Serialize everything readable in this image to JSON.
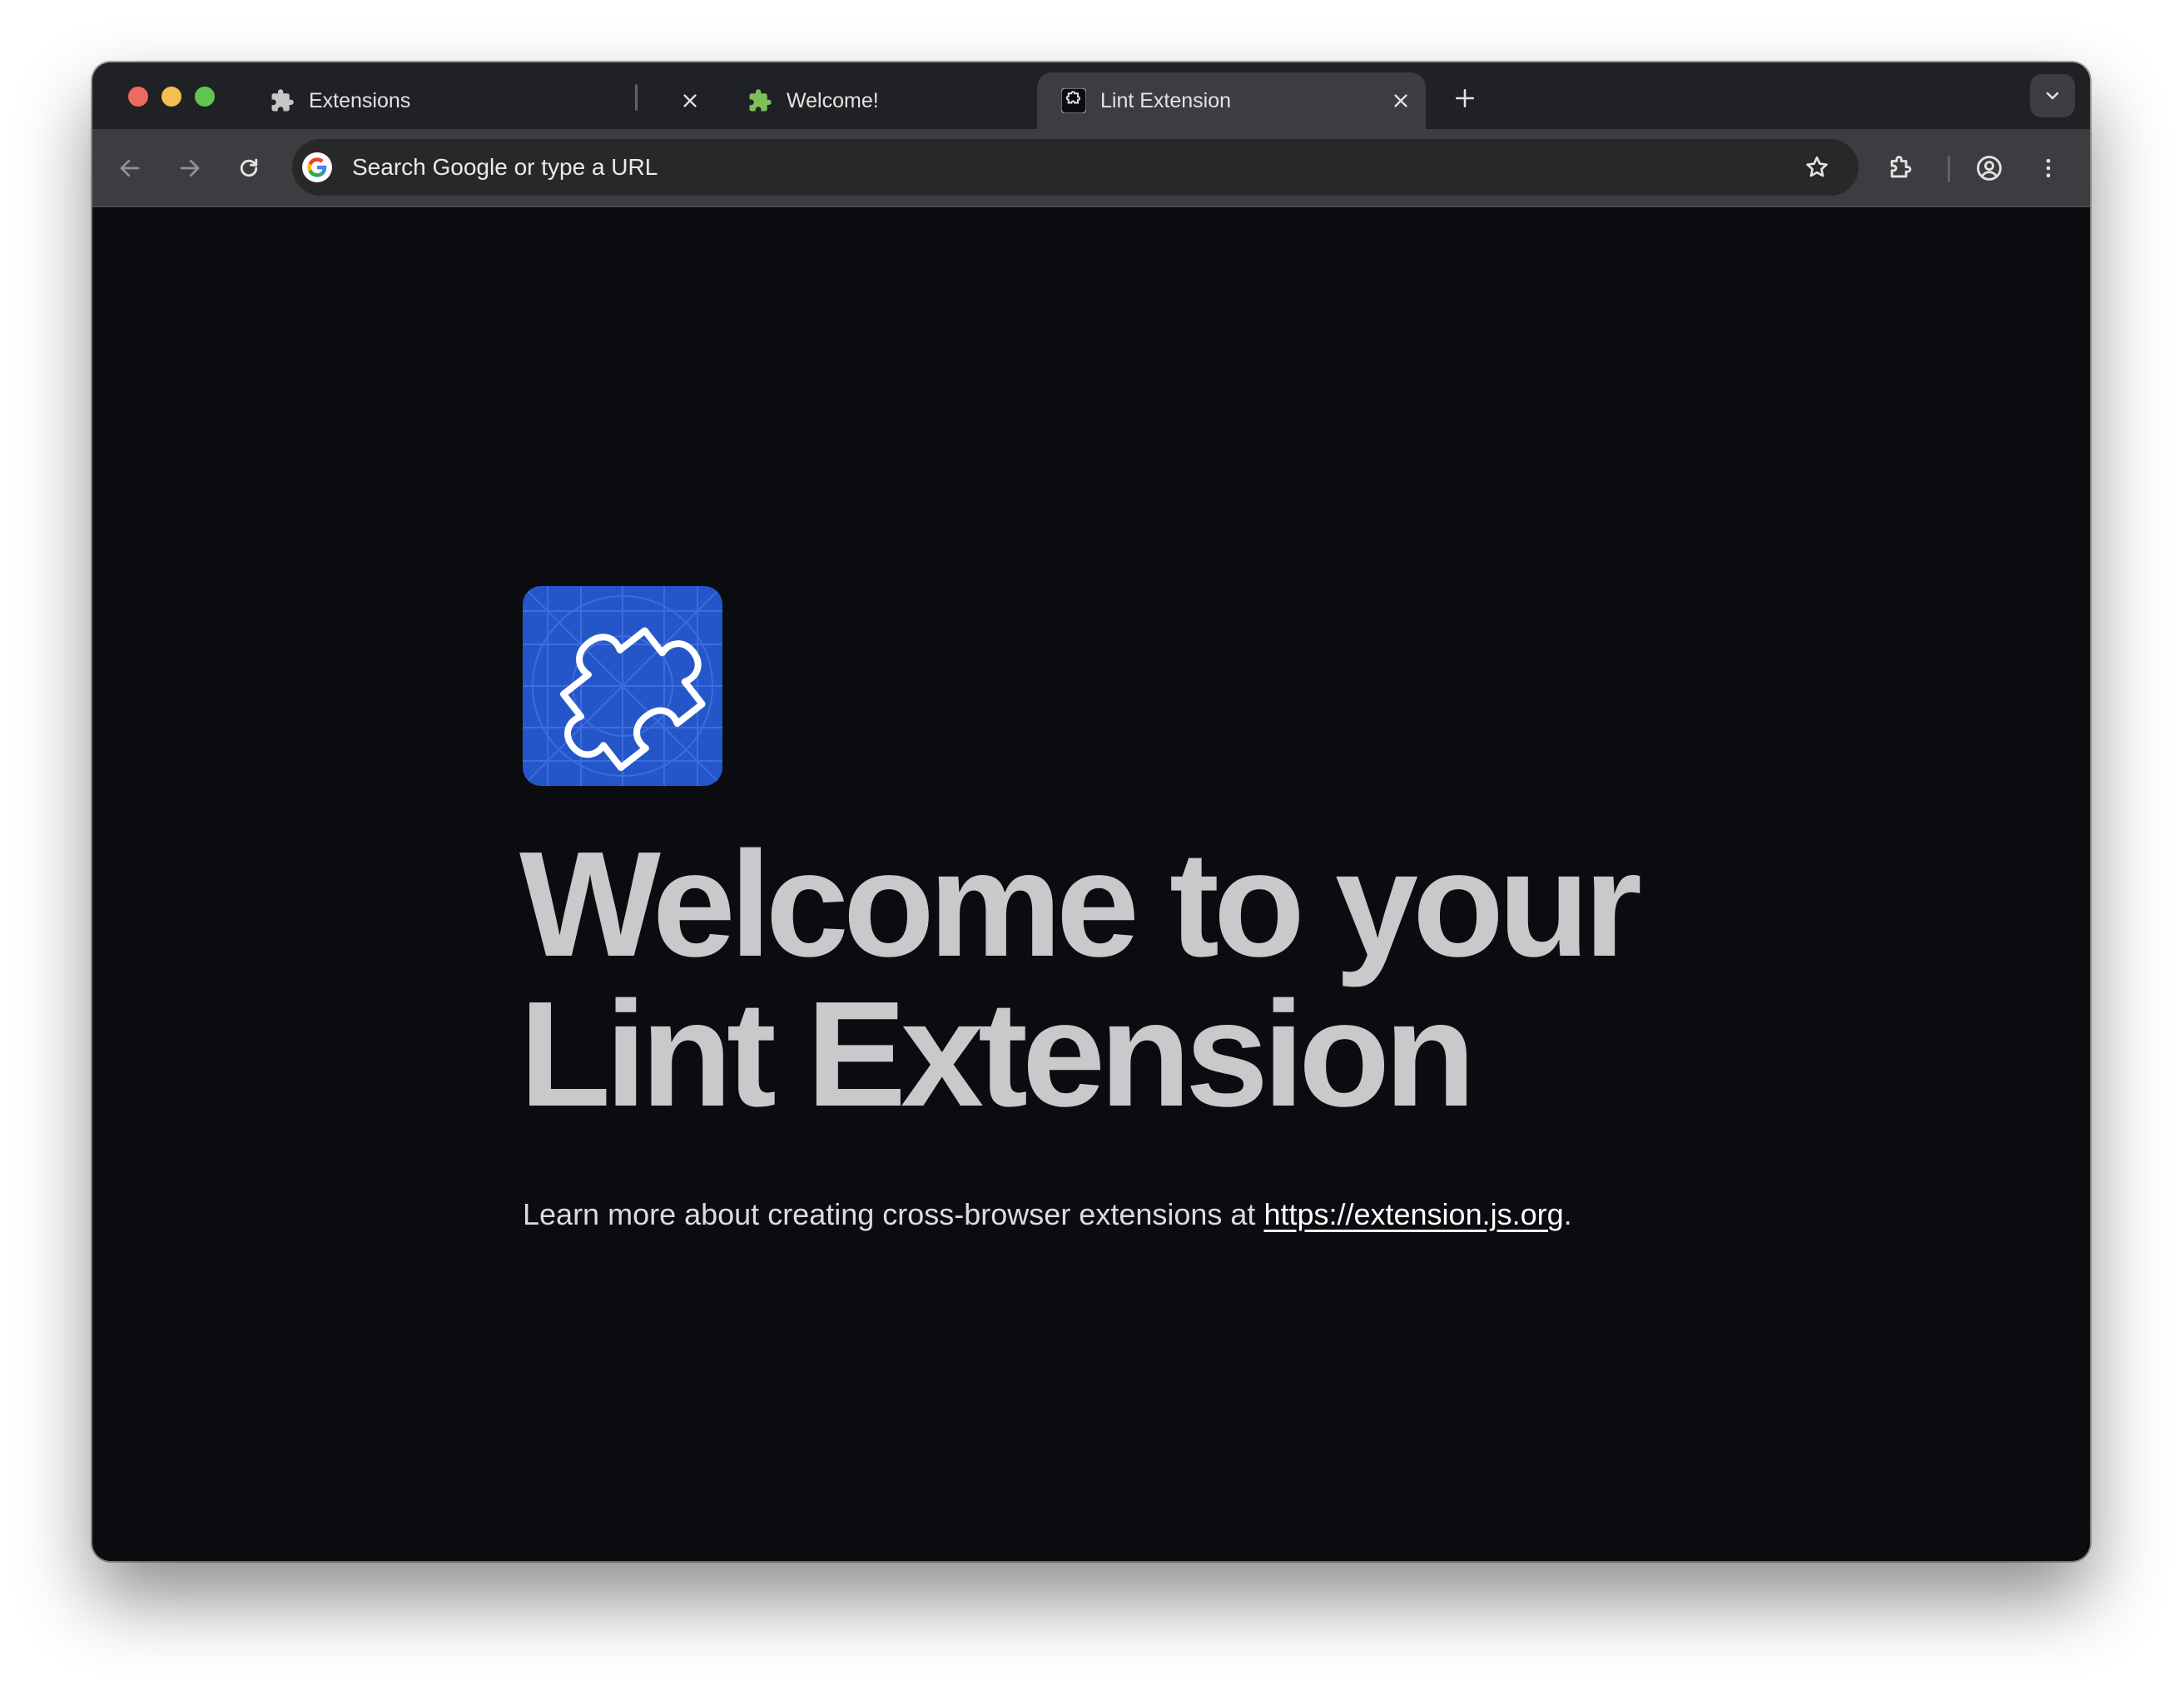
{
  "window": {
    "tabs": [
      {
        "title": "Extensions",
        "favicon": "puzzle-icon",
        "active": false
      },
      {
        "title": "Welcome!",
        "favicon": "green-puzzle-icon",
        "active": false
      },
      {
        "title": "Lint Extension",
        "favicon": "lint-extension-icon",
        "active": true
      }
    ]
  },
  "toolbar": {
    "omnibox_placeholder": "Search Google or type a URL"
  },
  "page": {
    "headline_line1": "Welcome to your",
    "headline_line2": "Lint Extension",
    "lead_text": "Learn more about creating cross-browser extensions at ",
    "lead_link": "https://extension.js.org",
    "lead_suffix": "."
  },
  "colors": {
    "page_background": "#0b0c10",
    "logo_blue": "#2556c9",
    "tabstrip": "#202124",
    "toolbar": "#3c3d40"
  }
}
